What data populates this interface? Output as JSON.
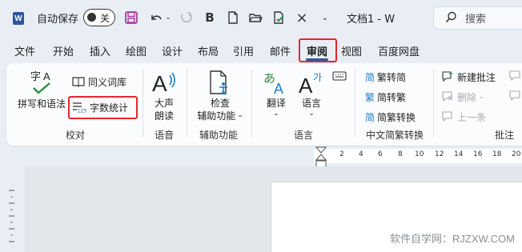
{
  "titlebar": {
    "autosave_label": "自动保存",
    "toggle_text": "关",
    "doc_title": "文档1 - W",
    "search_placeholder": "搜索",
    "qa_bold": "B",
    "icons": [
      "word-logo",
      "save-icon",
      "undo-icon",
      "redo-icon",
      "bold-icon",
      "new-doc-icon",
      "open-folder-icon",
      "check-icon",
      "close-icon",
      "more-icon",
      "search-icon"
    ]
  },
  "tabs": [
    {
      "label": "文件"
    },
    {
      "label": "开始"
    },
    {
      "label": "插入"
    },
    {
      "label": "绘图"
    },
    {
      "label": "设计"
    },
    {
      "label": "布局"
    },
    {
      "label": "引用"
    },
    {
      "label": "邮件"
    },
    {
      "label": "审阅",
      "active": true
    },
    {
      "label": "视图"
    },
    {
      "label": "百度网盘"
    }
  ],
  "ribbon": {
    "proofing": {
      "spelling_label": "拼写和语法",
      "spelling_icon_text": "字A",
      "thesaurus_label": "同义词库",
      "word_count_label": "字数统计",
      "group_label": "校对"
    },
    "speech": {
      "read_aloud_line1": "大声",
      "read_aloud_line2": "朗读",
      "group_label": "语音"
    },
    "accessibility": {
      "check_line1": "检查",
      "check_line2": "辅助功能",
      "group_label": "辅助功能"
    },
    "language": {
      "translate_label": "翻译",
      "language_label": "语言",
      "group_label": "语言"
    },
    "chinese_conversion": {
      "to_simplified": "繁转简",
      "to_traditional": "简转繁",
      "convert": "简繁转换",
      "group_label": "中文简繁转换"
    },
    "comments": {
      "new_comment": "新建批注",
      "delete": "删除",
      "previous": "上一条",
      "group_label": "批注"
    }
  },
  "ruler": {
    "numbers": [
      "2",
      "4",
      "6",
      "8",
      "10",
      "12",
      "14",
      "16",
      "18",
      "20"
    ]
  },
  "watermark": "软件自学网：RJZXW.COM",
  "colors": {
    "accent": "#2b579a",
    "highlight": "#e0292f",
    "save_purple": "#a33e9c",
    "translate_blue": "#1f7fc4",
    "check_green": "#2f8d46"
  }
}
